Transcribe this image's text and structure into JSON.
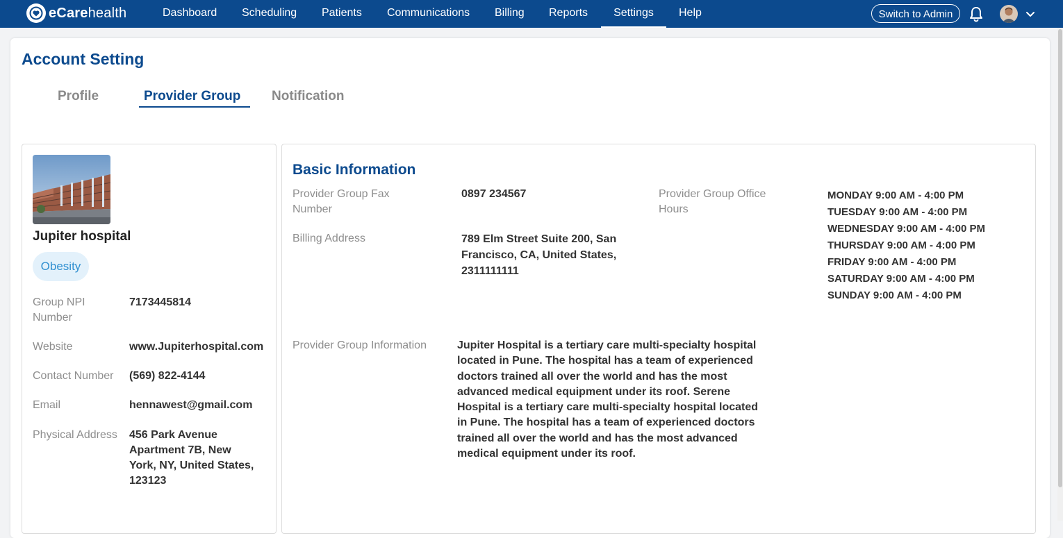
{
  "app": {
    "logo_text_bold": "eCare",
    "logo_text_rest": "health"
  },
  "nav": {
    "items": [
      {
        "label": "Dashboard"
      },
      {
        "label": "Scheduling"
      },
      {
        "label": "Patients"
      },
      {
        "label": "Communications"
      },
      {
        "label": "Billing"
      },
      {
        "label": "Reports"
      },
      {
        "label": "Settings",
        "active": true
      },
      {
        "label": "Help"
      }
    ],
    "switch_label": "Switch to Admin",
    "icons": {
      "bell": "bell-icon",
      "avatar": "user-avatar",
      "chevron": "chevron-down-icon"
    }
  },
  "page": {
    "title": "Account Setting",
    "tabs": [
      {
        "label": "Profile"
      },
      {
        "label": "Provider Group",
        "active": true
      },
      {
        "label": "Notification"
      }
    ]
  },
  "provider": {
    "name": "Jupiter hospital",
    "tag": "Obesity",
    "fields": [
      {
        "label": "Group NPI Number",
        "value": "7173445814"
      },
      {
        "label": "Website",
        "value": "www.Jupiterhospital.com"
      },
      {
        "label": "Contact Number",
        "value": "(569) 822-4144"
      },
      {
        "label": "Email",
        "value": "hennawest@gmail.com"
      },
      {
        "label": "Physical Address",
        "value": "456 Park Avenue Apartment 7B, New York, NY, United States, 123123"
      }
    ]
  },
  "basic": {
    "title": "Basic Information",
    "fax_label": "Provider Group Fax Number",
    "fax_value": "0897 234567",
    "billing_label": "Billing Address",
    "billing_value": "789 Elm Street Suite 200, San Francisco, CA, United States, 2311111111",
    "hours_label": "Provider Group Office Hours",
    "hours": [
      "MONDAY 9:00 AM - 4:00 PM",
      "TUESDAY 9:00 AM - 4:00 PM",
      "WEDNESDAY 9:00 AM - 4:00 PM",
      "THURSDAY 9:00 AM - 4:00 PM",
      "FRIDAY 9:00 AM - 4:00 PM",
      "SATURDAY 9:00 AM - 4:00 PM",
      "SUNDAY 9:00 AM - 4:00 PM"
    ],
    "info_label": "Provider Group Information",
    "info_value": "Jupiter Hospital is a tertiary care multi-specialty hospital located in Pune. The hospital has a team of experienced doctors trained all over the world and has the most advanced medical equipment under its roof. Serene Hospital is a tertiary care multi-specialty hospital located in Pune. The hospital has a team of experienced doctors trained all over the world and has the most advanced medical equipment under its roof."
  },
  "colors": {
    "brand": "#0c4a8e",
    "tag_bg": "#e3f1fb",
    "tag_text": "#2f8fd0"
  }
}
